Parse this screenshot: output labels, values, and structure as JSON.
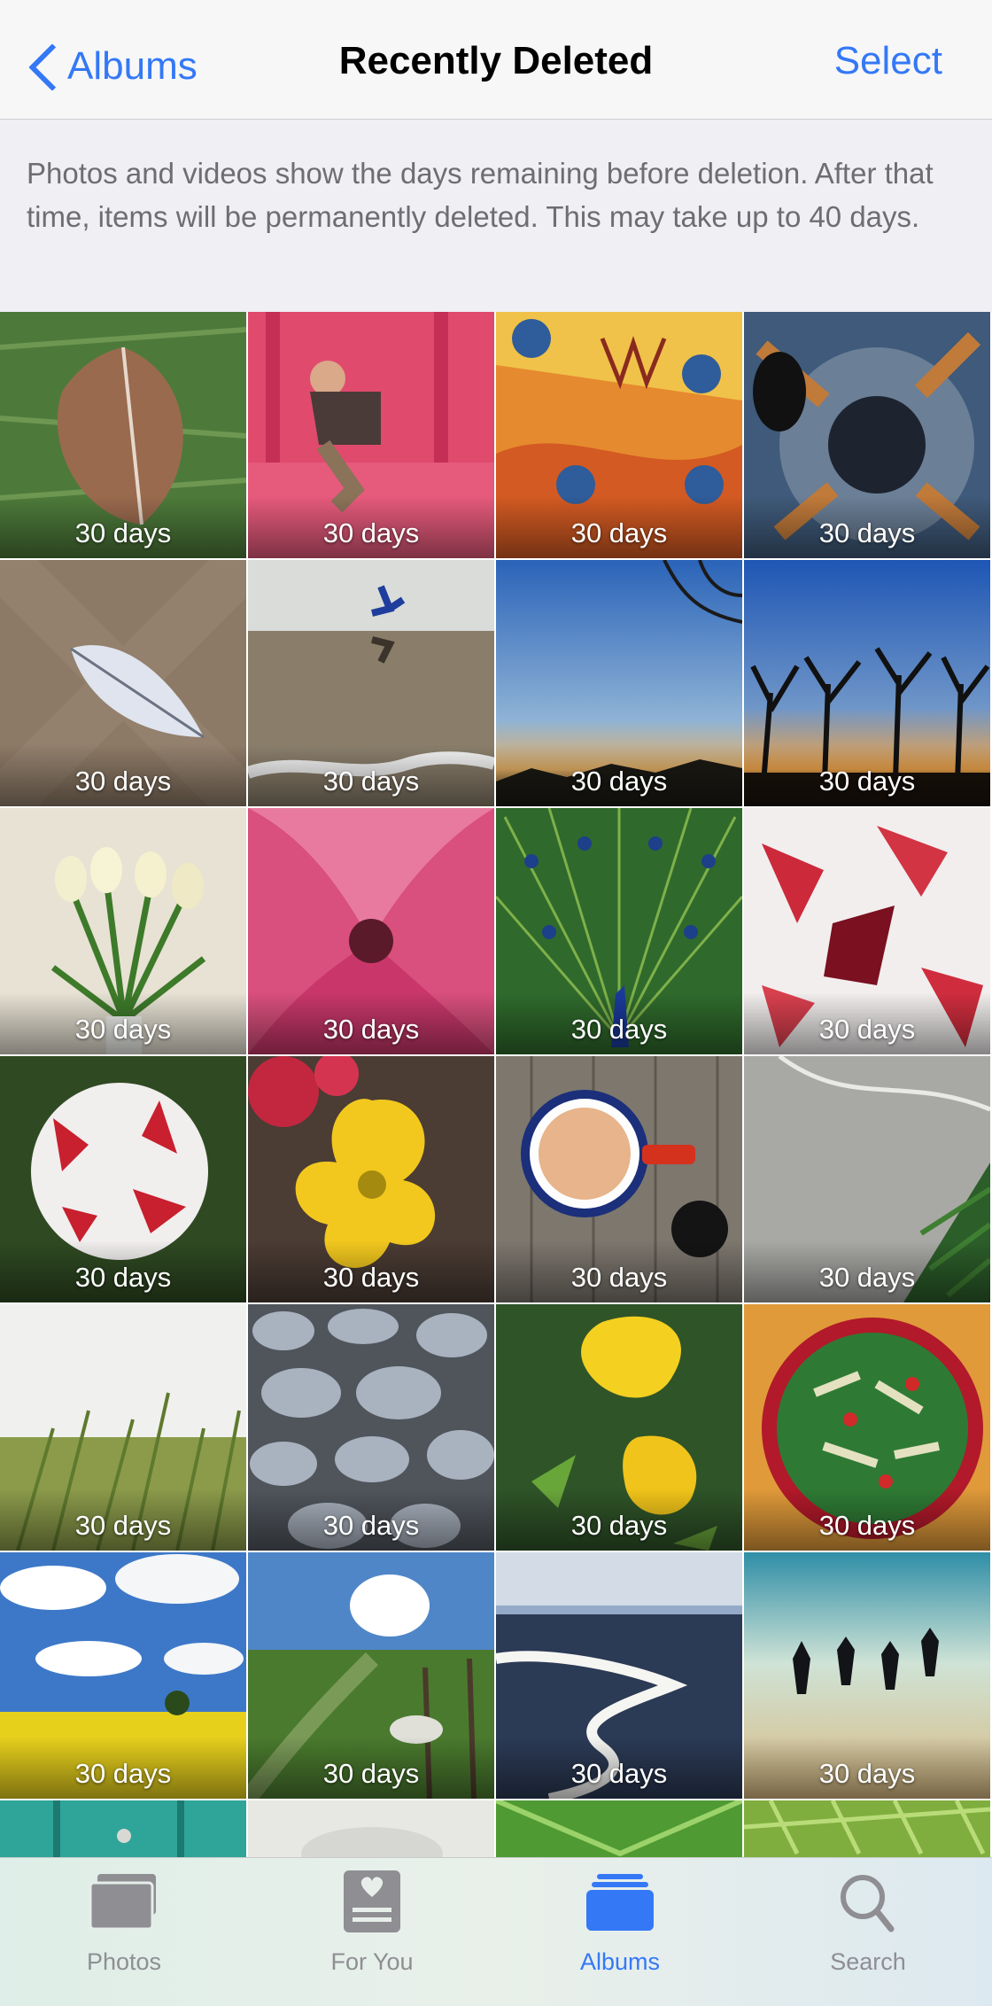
{
  "nav": {
    "back_label": "Albums",
    "title": "Recently Deleted",
    "select_label": "Select"
  },
  "info_text": "Photos and videos show the days remaining before deletion. After that time, items will be permanently deleted. This may take up to 40 days.",
  "photos": [
    {
      "name": "frosted-leaf",
      "days": "30 days"
    },
    {
      "name": "boy-jumping-pink-wall",
      "days": "30 days"
    },
    {
      "name": "rusty-painted-bolts",
      "days": "30 days"
    },
    {
      "name": "rusty-gear",
      "days": "30 days"
    },
    {
      "name": "leaf-on-sand",
      "days": "30 days"
    },
    {
      "name": "jumper-beach-reflection",
      "days": "30 days"
    },
    {
      "name": "sunset-tree-branches",
      "days": "30 days"
    },
    {
      "name": "tree-silhouettes-dusk",
      "days": "30 days"
    },
    {
      "name": "white-tulips-vase",
      "days": "30 days"
    },
    {
      "name": "pink-tulip-closeup",
      "days": "30 days"
    },
    {
      "name": "peacock",
      "days": "30 days"
    },
    {
      "name": "red-white-petals",
      "days": "30 days"
    },
    {
      "name": "red-white-tulip",
      "days": "30 days"
    },
    {
      "name": "yellow-poppy",
      "days": "30 days"
    },
    {
      "name": "tea-cup",
      "days": "30 days"
    },
    {
      "name": "stone-fern",
      "days": "30 days"
    },
    {
      "name": "dune-grass",
      "days": "30 days"
    },
    {
      "name": "pebbles",
      "days": "30 days"
    },
    {
      "name": "yellow-poppies",
      "days": "30 days"
    },
    {
      "name": "salad-bowl",
      "days": "30 days"
    },
    {
      "name": "rapeseed-field",
      "days": "30 days"
    },
    {
      "name": "green-path-fence",
      "days": "30 days"
    },
    {
      "name": "beach-shoreline",
      "days": "30 days"
    },
    {
      "name": "people-jumping-beach",
      "days": "30 days"
    },
    {
      "name": "teal-door",
      "days": ""
    },
    {
      "name": "cloudy-sky",
      "days": ""
    },
    {
      "name": "green-leaf",
      "days": ""
    },
    {
      "name": "fern",
      "days": ""
    }
  ],
  "tabs": [
    {
      "label": "Photos",
      "icon": "photos-icon",
      "active": false
    },
    {
      "label": "For You",
      "icon": "for-you-icon",
      "active": false
    },
    {
      "label": "Albums",
      "icon": "albums-icon",
      "active": true
    },
    {
      "label": "Search",
      "icon": "search-icon",
      "active": false
    }
  ],
  "colors": {
    "accent": "#3478f6",
    "inactive": "#8e8e93"
  }
}
